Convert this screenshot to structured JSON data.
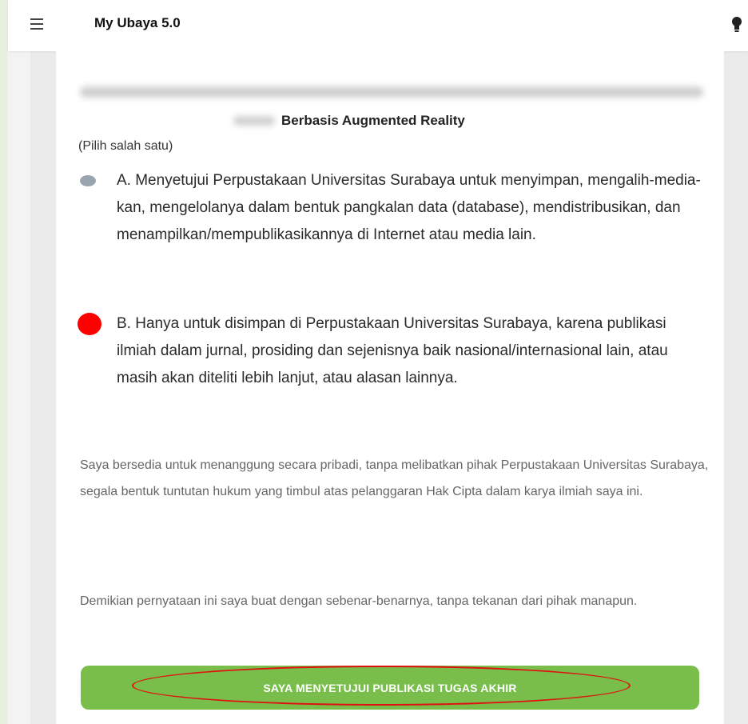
{
  "app": {
    "title": "My Ubaya 5.0"
  },
  "form": {
    "title_tail": "Berbasis Augmented Reality",
    "choose_note": "(Pilih salah satu)",
    "options": [
      {
        "label": "A. Menyetujui Perpustakaan Universitas Surabaya untuk menyimpan, mengalih-media-kan, mengelolanya dalam bentuk pangkalan data (database), mendistribusikan, dan menampilkan/mempublikasikannya di Internet atau media lain."
      },
      {
        "label": "B. Hanya untuk disimpan di Perpustakaan Universitas Surabaya, karena publikasi ilmiah dalam jurnal, prosiding dan sejenisnya baik nasional/internasional lain, atau masih akan diteliti lebih lanjut, atau alasan lainnya."
      }
    ],
    "statement_1": "Saya bersedia untuk menanggung secara pribadi, tanpa melibatkan pihak Perpustakaan Universitas Surabaya, segala bentuk tuntutan hukum yang timbul atas pelanggaran Hak Cipta dalam karya ilmiah saya ini.",
    "statement_2": "Demikian pernyataan ini saya buat dengan sebenar-benarnya, tanpa tekanan dari pihak manapun.",
    "agree_button": "SAYA MENYETUJUI PUBLIKASI TUGAS AKHIR"
  },
  "colors": {
    "button": "#79bd4a",
    "annotation": "#e01010",
    "radio_unselected": "#9aa4ae",
    "radio_marked": "#ff0000"
  }
}
